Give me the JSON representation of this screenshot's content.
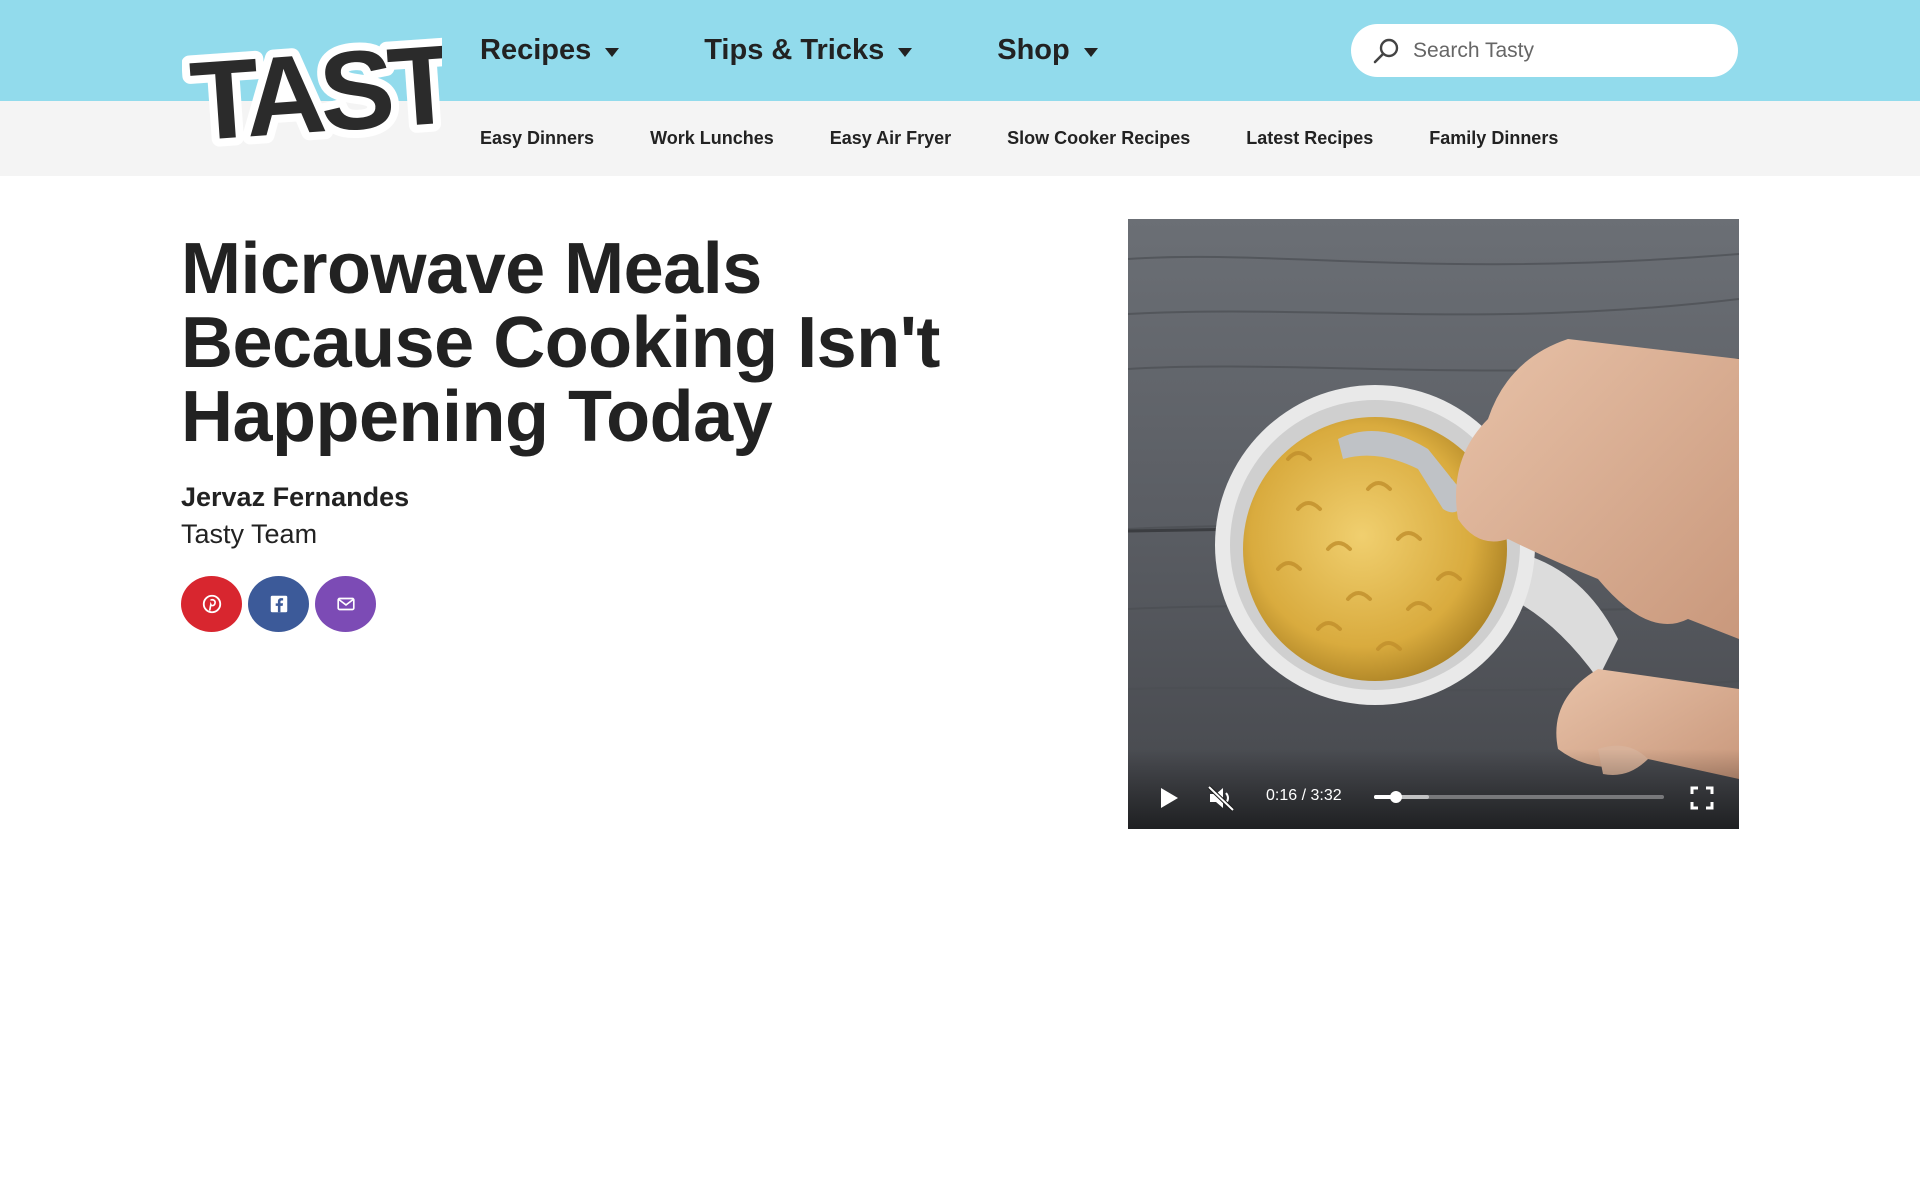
{
  "brand": {
    "name": "TASTY",
    "header_color": "#92dbec"
  },
  "header": {
    "nav": [
      {
        "label": "Recipes",
        "icon": "caret-down-icon"
      },
      {
        "label": "Tips & Tricks",
        "icon": "caret-down-icon"
      },
      {
        "label": "Shop",
        "icon": "caret-down-icon"
      }
    ],
    "search": {
      "placeholder": "Search Tasty",
      "icon": "search-icon"
    }
  },
  "subnav": {
    "items": [
      "Easy Dinners",
      "Work Lunches",
      "Easy Air Fryer",
      "Slow Cooker Recipes",
      "Latest Recipes",
      "Family Dinners"
    ]
  },
  "article": {
    "title": "Microwave Meals Because Cooking Isn't Happening Today",
    "author": {
      "name": "Jervaz Fernandes",
      "team": "Tasty Team"
    },
    "share": [
      {
        "network": "pinterest",
        "icon": "pinterest-icon",
        "color": "#d8262f"
      },
      {
        "network": "facebook",
        "icon": "facebook-icon",
        "color": "#3c5a99"
      },
      {
        "network": "email",
        "icon": "email-icon",
        "color": "#7c4bb5"
      }
    ]
  },
  "video": {
    "time_display": "0:16 / 3:32",
    "progress": 0.075,
    "buffered": 0.19,
    "muted": true,
    "paused": true
  }
}
